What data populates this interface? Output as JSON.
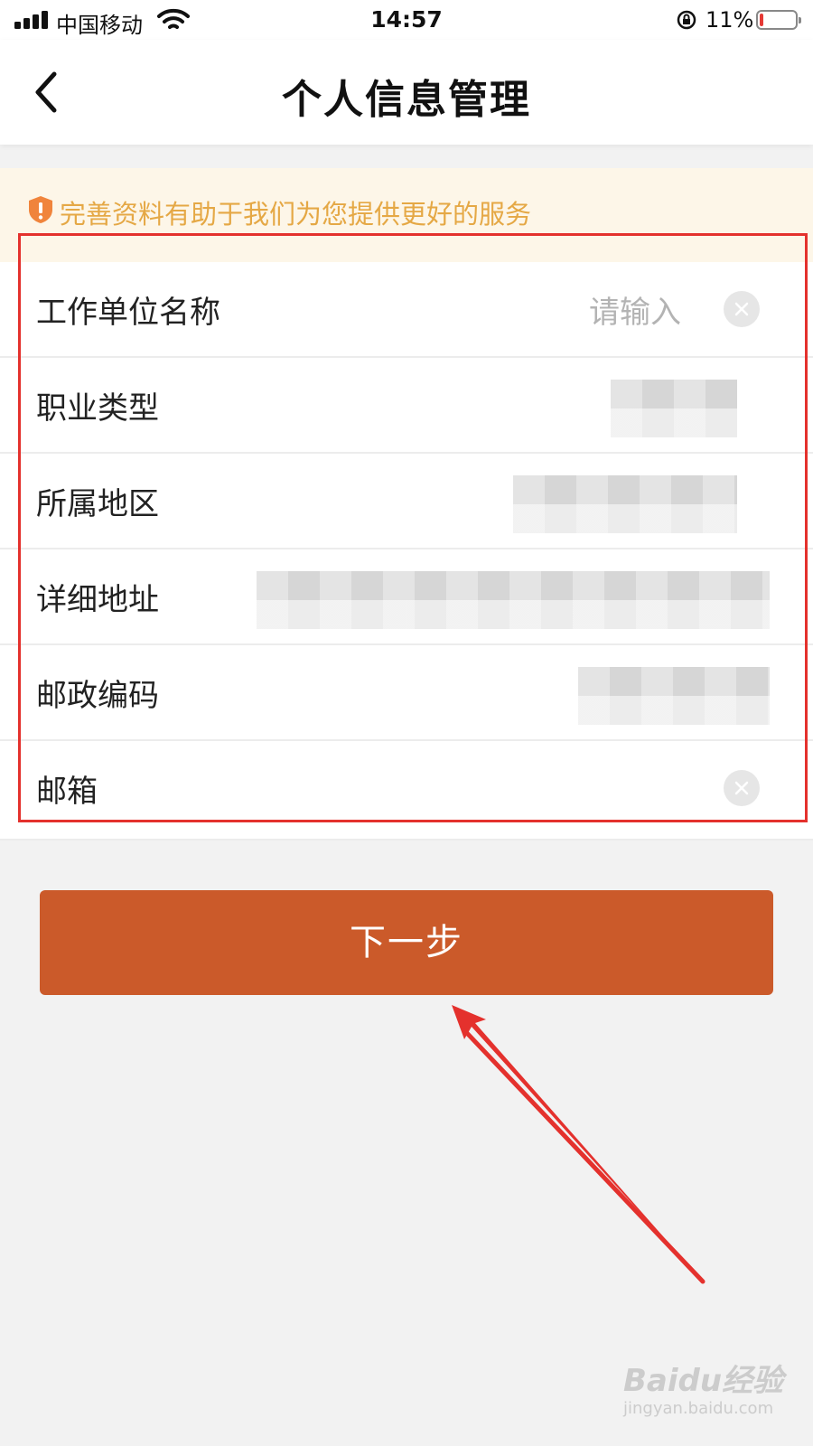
{
  "status_bar": {
    "carrier": "中国移动",
    "time": "14:57",
    "battery_percent": "11%",
    "battery_level": 0.11
  },
  "header": {
    "back_icon": "chevron-left-icon",
    "title": "个人信息管理"
  },
  "notice": {
    "icon": "warning-shield-icon",
    "text": "完善资料有助于我们为您提供更好的服务"
  },
  "form": {
    "rows": [
      {
        "label": "工作单位名称",
        "placeholder": "请输入",
        "has_clear": true
      },
      {
        "label": "职业类型",
        "value": ""
      },
      {
        "label": "所属地区",
        "value": ""
      },
      {
        "label": "详细地址",
        "value": ""
      },
      {
        "label": "邮政编码",
        "value": ""
      },
      {
        "label": "邮箱",
        "value": "",
        "has_clear": true
      }
    ]
  },
  "actions": {
    "next_label": "下一步"
  },
  "annotations": {
    "highlight_color": "#e4312d",
    "arrow_color": "#e4312d"
  },
  "watermark": {
    "logo_text": "Baidu经验",
    "url": "jingyan.baidu.com"
  },
  "colors": {
    "accent": "#cb5a2a",
    "notice_bg": "#fdf6e8",
    "notice_text": "#e5a845"
  }
}
